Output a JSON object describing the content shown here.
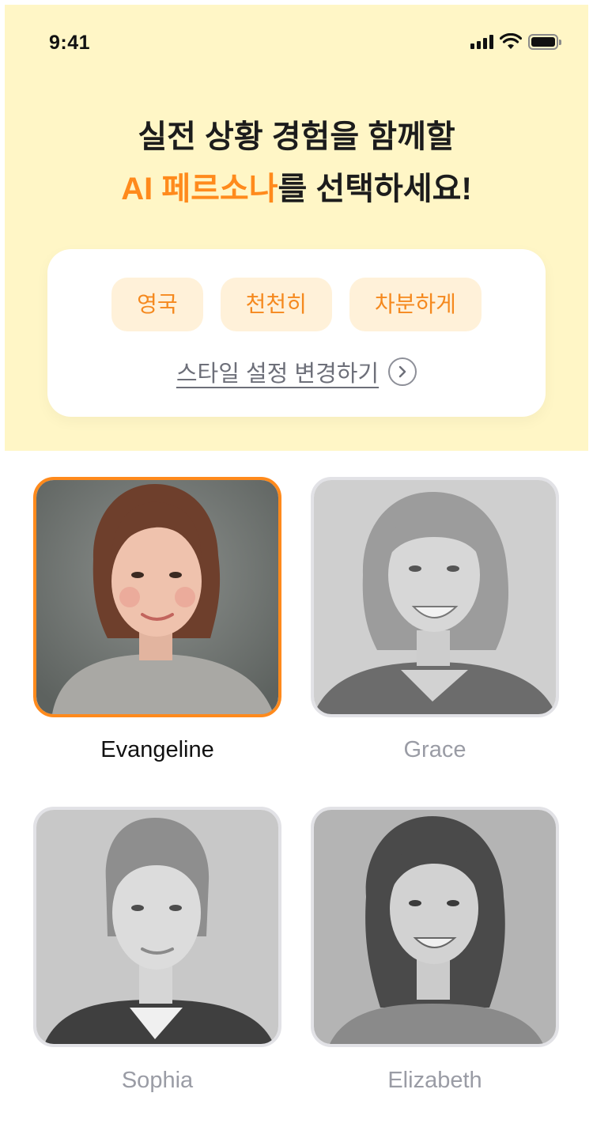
{
  "status_bar": {
    "time": "9:41",
    "icons": [
      "signal-icon",
      "wifi-icon",
      "battery-icon"
    ]
  },
  "header": {
    "line1": "실전 상황 경험을 함께할",
    "line2_accent": "AI 페르소나",
    "line2_rest": "를 선택하세요!"
  },
  "style_settings": {
    "chips": [
      "영국",
      "천천히",
      "차분하게"
    ],
    "change_label": "스타일 설정 변경하기"
  },
  "personas": [
    {
      "name": "Evangeline",
      "selected": true
    },
    {
      "name": "Grace",
      "selected": false
    },
    {
      "name": "Sophia",
      "selected": false
    },
    {
      "name": "Elizabeth",
      "selected": false
    }
  ],
  "colors": {
    "header_bg": "#fff6c6",
    "accent": "#ff8a1c",
    "chip_bg": "#fff1d9",
    "muted_text": "#9a9ca5"
  }
}
